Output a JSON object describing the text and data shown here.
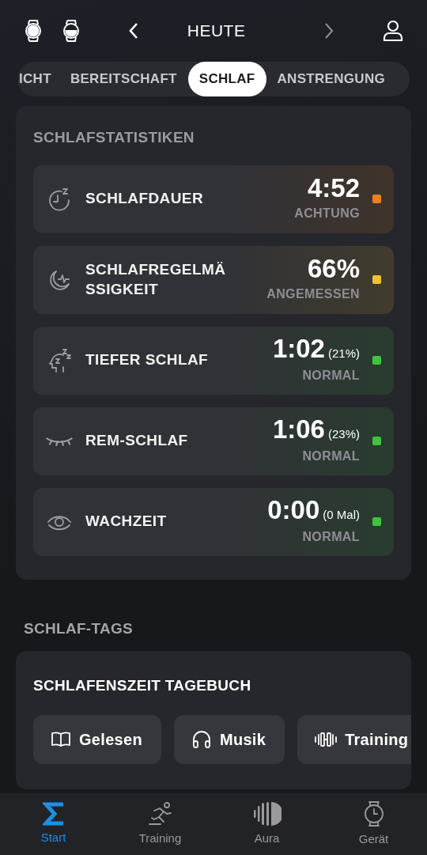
{
  "header": {
    "title": "HEUTE"
  },
  "tabs": [
    {
      "label": "ICHT",
      "selected": false
    },
    {
      "label": "BEREITSCHAFT",
      "selected": false
    },
    {
      "label": "SCHLAF",
      "selected": true
    },
    {
      "label": "ANSTRENGUNG",
      "selected": false
    }
  ],
  "stats": {
    "title": "SCHLAFSTATISTIKEN",
    "rows": [
      {
        "label": "SCHLAFDAUER",
        "value": "4:52",
        "status": "ACHTUNG",
        "color": "#e8821e"
      },
      {
        "label": "SCHLAFREGELMÄSSIGKEIT",
        "value": "66%",
        "status": "ANGEMESSEN",
        "color": "#f0c232"
      },
      {
        "label": "TIEFER SCHLAF",
        "value": "1:02",
        "detail": "(21%)",
        "status": "NORMAL",
        "color": "#3ec43e"
      },
      {
        "label": "REM-SCHLAF",
        "value": "1:06",
        "detail": "(23%)",
        "status": "NORMAL",
        "color": "#3ec43e"
      },
      {
        "label": "WACHZEIT",
        "value": "0:00",
        "detail": "(0 Mal)",
        "status": "NORMAL",
        "color": "#3ec43e"
      }
    ]
  },
  "tags": {
    "title": "SCHLAF-TAGS",
    "card_title": "SCHLAFENSZEIT TAGEBUCH",
    "chips": [
      {
        "label": "Gelesen"
      },
      {
        "label": "Musik"
      },
      {
        "label": "Training"
      }
    ]
  },
  "bottom_nav": [
    {
      "label": "Start",
      "selected": true
    },
    {
      "label": "Training",
      "selected": false
    },
    {
      "label": "Aura",
      "selected": false
    },
    {
      "label": "Gerät",
      "selected": false
    }
  ]
}
